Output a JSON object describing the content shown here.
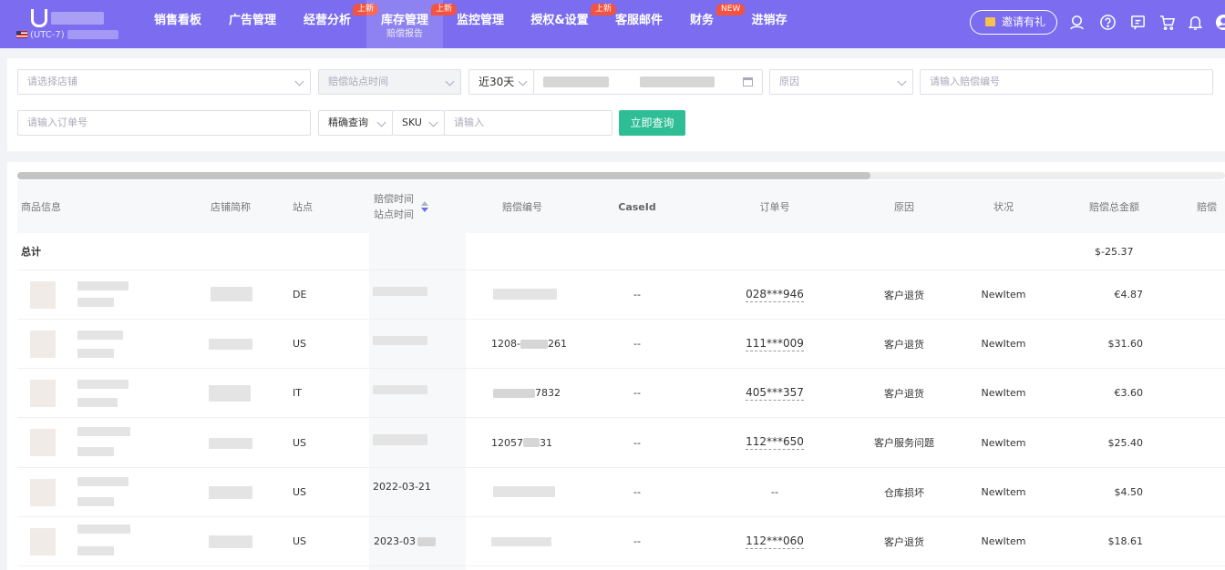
{
  "nav": {
    "timezone": "(UTC-7)",
    "items": [
      {
        "label": "销售看板",
        "badge": ""
      },
      {
        "label": "广告管理",
        "badge": ""
      },
      {
        "label": "经营分析",
        "badge": "上新"
      },
      {
        "label": "库存管理",
        "badge": "上新",
        "sub": "赔偿报告",
        "active": true
      },
      {
        "label": "监控管理",
        "badge": ""
      },
      {
        "label": "授权&设置",
        "badge": "上新"
      },
      {
        "label": "客服邮件",
        "badge": ""
      },
      {
        "label": "财务",
        "badge": "NEW"
      },
      {
        "label": "进销存",
        "badge": ""
      }
    ],
    "invite_label": "邀请有礼",
    "icons": [
      "headset-icon",
      "help-icon",
      "message-icon",
      "cart-icon",
      "bell-icon",
      "avatar-icon"
    ]
  },
  "filters": {
    "store_placeholder": "请选择店铺",
    "time_type_placeholder": "赔偿站点时间",
    "range_value": "近30天",
    "reason_placeholder": "原因",
    "compensation_no_placeholder": "请输入赔偿编号",
    "order_no_placeholder": "请输入订单号",
    "match_mode": "精确查询",
    "field_type": "SKU",
    "keyword_placeholder": "请输入",
    "query_button": "立即查询"
  },
  "table": {
    "columns": {
      "product": "商品信息",
      "store": "店铺简称",
      "site": "站点",
      "time_line1": "赔偿时间",
      "time_line2": "站点时间",
      "comp_no": "赔偿编号",
      "case_id": "CaseId",
      "order_no": "订单号",
      "reason": "原因",
      "status": "状况",
      "amount": "赔偿总金额",
      "more": "赔偿"
    },
    "total": {
      "label": "总计",
      "amount": "$-25.37"
    },
    "rows": [
      {
        "site": "DE",
        "time": "",
        "comp_no": "",
        "case_id": "--",
        "order_no": "028***946",
        "reason": "客户退货",
        "status": "NewItem",
        "amount": "€4.87"
      },
      {
        "site": "US",
        "time": "",
        "comp_no": "1208-",
        "comp_tail": "261",
        "case_id": "--",
        "order_no": "111***009",
        "reason": "客户退货",
        "status": "NewItem",
        "amount": "$31.60"
      },
      {
        "site": "IT",
        "time": "",
        "comp_no": "",
        "comp_tail": "7832",
        "case_id": "--",
        "order_no": "405***357",
        "reason": "客户退货",
        "status": "NewItem",
        "amount": "€3.60"
      },
      {
        "site": "US",
        "time": "",
        "comp_no": "12057",
        "comp_tail": "31",
        "case_id": "--",
        "order_no": "112***650",
        "reason": "客户服务问题",
        "status": "NewItem",
        "amount": "$25.40"
      },
      {
        "site": "US",
        "time": "2022-03-21",
        "comp_no": "",
        "case_id": "--",
        "order_no": "--",
        "reason": "仓库损坏",
        "status": "NewItem",
        "amount": "$4.50"
      },
      {
        "site": "US",
        "time": "2023-03",
        "comp_no": "",
        "case_id": "--",
        "order_no": "112***060",
        "reason": "客户退货",
        "status": "NewItem",
        "amount": "$18.61"
      }
    ]
  },
  "colors": {
    "nav_bg": "#7b6cf0",
    "primary_btn": "#2ebd95",
    "badge": "#f3533f"
  }
}
